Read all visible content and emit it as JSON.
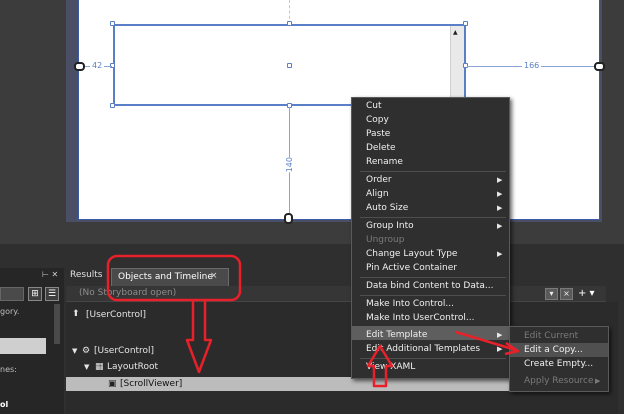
{
  "artboard": {
    "dim_left": "42",
    "dim_right": "166",
    "dim_bottom": "140"
  },
  "left_strip": {
    "text_1": "gory.",
    "text_2": "nes:",
    "text_3": "ol",
    "btn1_glyph": "⊞",
    "btn2_glyph": "☰"
  },
  "tabs": {
    "results": "Results",
    "objects": "Objects and Timeline",
    "close_glyph": "×",
    "pin_glyph": "⊢ ✕"
  },
  "storyboard": {
    "text": "(No Storyboard open)",
    "plus_glyph": "+ ▾"
  },
  "tree": {
    "usercontrol_top": "[UserControl]",
    "usercontrol": "[UserControl]",
    "layoutroot": "LayoutRoot",
    "scrollviewer": "[ScrollViewer]"
  },
  "context_menu": {
    "items": [
      {
        "label": "Cut"
      },
      {
        "label": "Copy"
      },
      {
        "label": "Paste"
      },
      {
        "label": "Delete"
      },
      {
        "label": "Rename"
      },
      {
        "label": "Order"
      },
      {
        "label": "Align"
      },
      {
        "label": "Auto Size"
      },
      {
        "label": "Group Into"
      },
      {
        "label": "Ungroup"
      },
      {
        "label": "Change Layout Type"
      },
      {
        "label": "Pin Active Container"
      },
      {
        "label": "Data bind Content to Data..."
      },
      {
        "label": "Make Into Control..."
      },
      {
        "label": "Make Into UserControl..."
      },
      {
        "label": "Edit Template"
      },
      {
        "label": "Edit Additional Templates"
      },
      {
        "label": "View XAML"
      }
    ]
  },
  "submenu": {
    "items": [
      {
        "label": "Edit Current"
      },
      {
        "label": "Edit a Copy..."
      },
      {
        "label": "Create Empty..."
      },
      {
        "label": "Apply Resource"
      }
    ]
  },
  "colors": {
    "annotation_red": "#e8202a",
    "selection_blue": "#5b7fc7"
  }
}
